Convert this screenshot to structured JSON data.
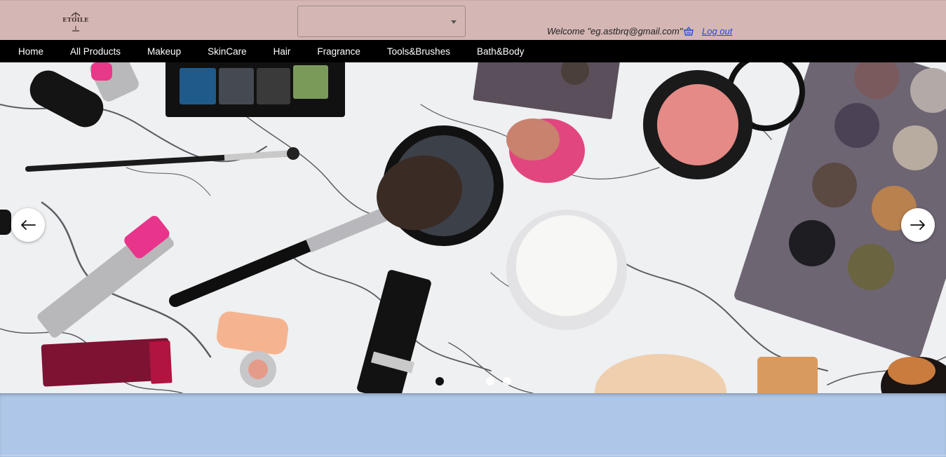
{
  "header": {
    "logo_text": "ETOILE",
    "search_select": {
      "value": ""
    },
    "welcome_text": "Welcome \"eg.astbrq@gmail.com\"",
    "cart_icon": "shopping-basket-icon",
    "logout_label": "Log out",
    "colors": {
      "header_bg": "#d4b6b4",
      "link": "#1a4be0"
    }
  },
  "nav": {
    "items": [
      {
        "label": "Home"
      },
      {
        "label": "All Products"
      },
      {
        "label": "Makeup"
      },
      {
        "label": "SkinCare"
      },
      {
        "label": "Hair"
      },
      {
        "label": "Fragrance"
      },
      {
        "label": "Tools&Brushes"
      },
      {
        "label": "Bath&Body"
      }
    ],
    "colors": {
      "bg": "#000000",
      "text": "#ffffff"
    }
  },
  "carousel": {
    "image": "makeup-products-on-marble-photo",
    "prev_icon": "arrow-left-icon",
    "next_icon": "arrow-right-icon",
    "slide_count": 3,
    "active_slide": 1
  },
  "page": {
    "background": "#aec7e8"
  }
}
